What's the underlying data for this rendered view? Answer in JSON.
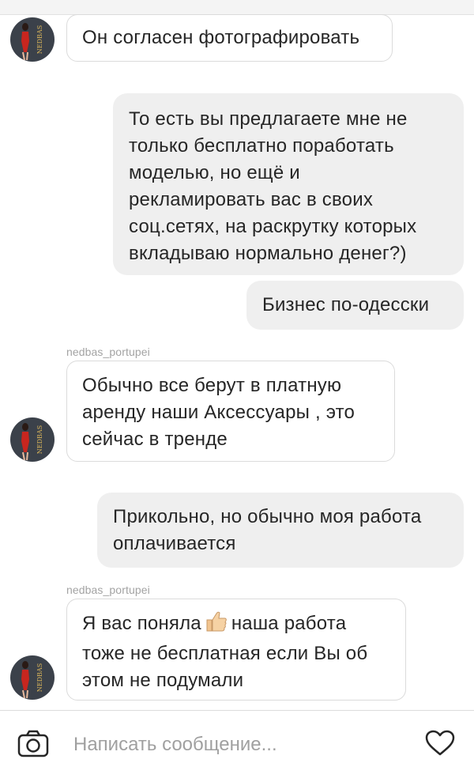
{
  "contact": {
    "username": "nedbas_portupei",
    "avatar_text": "NEDBAS"
  },
  "messages": [
    {
      "from": "them",
      "text": "Он согласен фотографировать"
    },
    {
      "from": "me",
      "lines": [
        "То есть вы предлагаете мне не",
        "только бесплатно поработать",
        "моделью, но ещё и",
        "рекламировать вас в своих",
        "соц.сетях, на раскрутку которых",
        "вкладываю нормально денег?)"
      ]
    },
    {
      "from": "me",
      "text": "Бизнес по-одесски"
    },
    {
      "from": "them",
      "sender": "nedbas_portupei",
      "lines": [
        "Обычно все берут в платную",
        "аренду наши Аксессуары , это",
        "сейчас в тренде"
      ]
    },
    {
      "from": "me",
      "lines": [
        "Прикольно, но обычно моя работа",
        "оплачивается"
      ]
    },
    {
      "from": "them",
      "sender": "nedbas_portupei",
      "line1_before": "Я вас поняла",
      "line1_after": "наша работа",
      "lines": [
        "тоже не бесплатная если Вы об",
        "этом не подумали"
      ]
    }
  ],
  "composer": {
    "placeholder": "Написать сообщение...",
    "left_icon": "camera-icon",
    "right_icon": "heart-icon"
  },
  "colors": {
    "outgoing_bubble": "#efefef",
    "incoming_border": "#dbdbdb",
    "sender_name": "#a3a3a3",
    "placeholder": "#a0a0a0",
    "avatar_bg": "#3b414a"
  }
}
